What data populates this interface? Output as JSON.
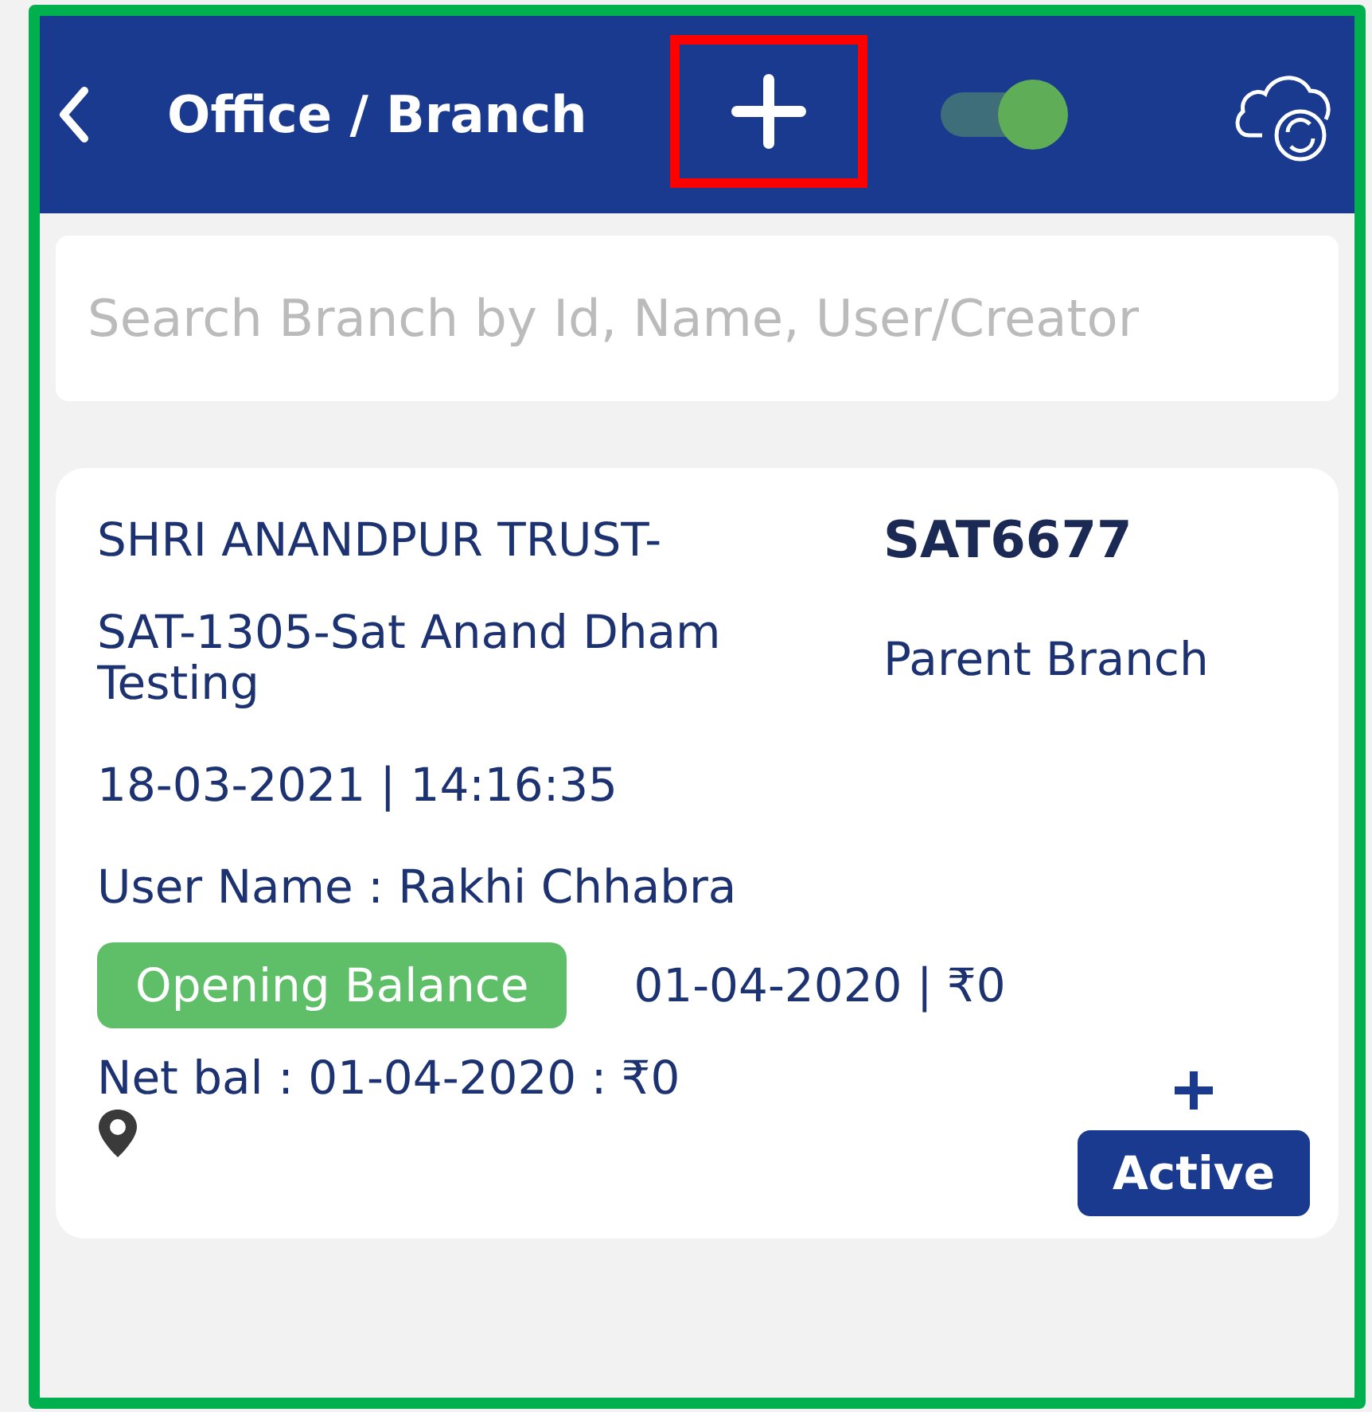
{
  "header": {
    "title": "Office / Branch",
    "sync_toggle": {
      "on": true
    }
  },
  "search": {
    "placeholder": "Search Branch by Id, Name, User/Creator"
  },
  "branches": [
    {
      "company": "SHRI ANANDPUR TRUST-",
      "code": "SAT6677",
      "branch": "SAT-1305-Sat Anand Dham Testing",
      "branch_type": "Parent Branch",
      "created": "18-03-2021 | 14:16:35",
      "user": "User Name : Rakhi Chhabra",
      "opening_label": "Opening Balance",
      "opening_value": "01-04-2020 | ₹0",
      "net_balance": "Net bal : 01-04-2020 : ₹0",
      "status": "Active"
    }
  ]
}
